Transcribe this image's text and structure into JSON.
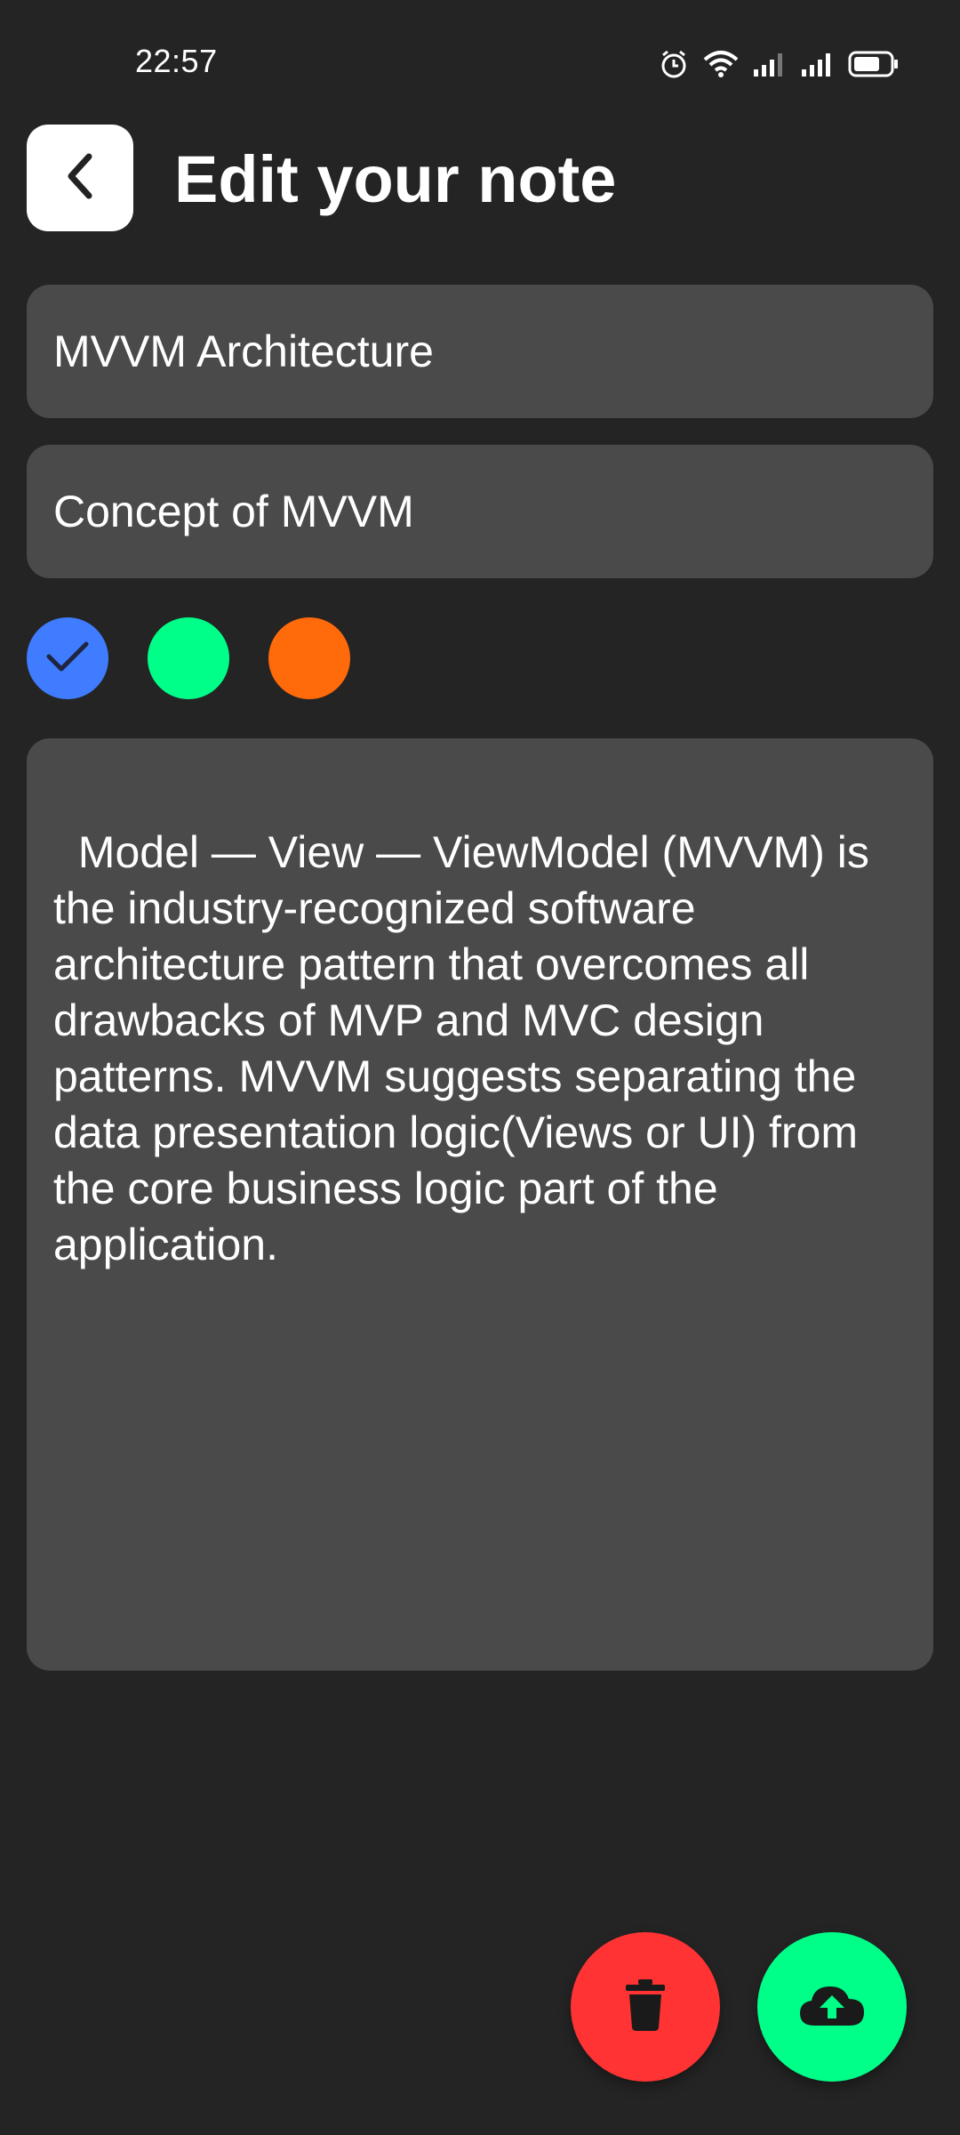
{
  "status_bar": {
    "time": "22:57",
    "icons": [
      "alarm-icon",
      "wifi-icon",
      "signal-icon",
      "signal-icon",
      "battery-icon"
    ]
  },
  "header": {
    "back_icon": "chevron-left-icon",
    "title": "Edit your note"
  },
  "form": {
    "title_value": "MVVM Architecture",
    "subtitle_value": "Concept of MVVM",
    "note_value": "Model — View — ViewModel (MVVM) is the industry-recognized software architecture pattern that overcomes all drawbacks of MVP and MVC design patterns. MVVM suggests separating the data presentation logic(Views or UI) from the core business logic part of the application."
  },
  "colors": {
    "background": "#242424",
    "field": "#4a4a4a",
    "swatches": [
      {
        "name": "blue",
        "hex": "#3f7cff",
        "selected": true
      },
      {
        "name": "green",
        "hex": "#00ff88",
        "selected": false
      },
      {
        "name": "orange",
        "hex": "#ff6a0a",
        "selected": false
      }
    ],
    "delete": "#ff3333",
    "upload": "#00ff88"
  },
  "actions": {
    "delete_icon": "trash-icon",
    "upload_icon": "cloud-upload-icon"
  }
}
